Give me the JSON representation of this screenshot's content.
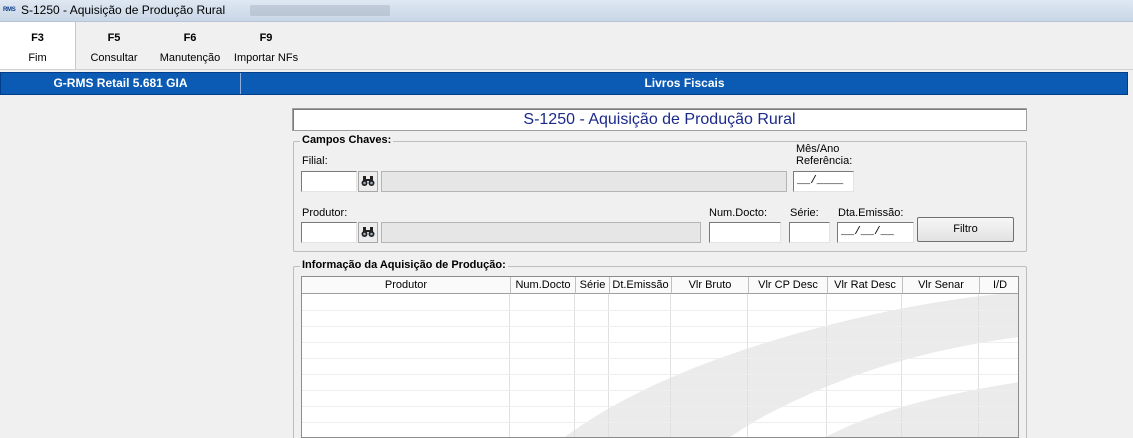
{
  "window": {
    "title": "S-1250 - Aquisição de Produção Rural",
    "icon_text": "RMS"
  },
  "toolbar": {
    "items": [
      {
        "key": "F3",
        "label": "Fim"
      },
      {
        "key": "F5",
        "label": "Consultar"
      },
      {
        "key": "F6",
        "label": "Manutenção"
      },
      {
        "key": "F9",
        "label": "Importar NFs"
      }
    ]
  },
  "bar": {
    "left": "G-RMS Retail 5.681 GIA",
    "right": "Livros Fiscais"
  },
  "form_title": "S-1250 - Aquisição de Produção Rural",
  "campos": {
    "title": "Campos Chaves:",
    "filial_label": "Filial:",
    "mesano_label": "Mês/Ano\nReferência:",
    "mesano_value": "__/____",
    "produtor_label": "Produtor:",
    "numdocto_label": "Num.Docto:",
    "serie_label": "Série:",
    "dtemissao_label": "Dta.Emissão:",
    "dtemissao_value": "__/__/__",
    "filtro_button": "Filtro"
  },
  "info": {
    "title": "Informação da Aquisição de Produção:",
    "columns": [
      "Produtor",
      "Num.Docto",
      "Série",
      "Dt.Emissão",
      "Vlr Bruto",
      "Vlr CP Desc",
      "Vlr Rat Desc",
      "Vlr Senar",
      "I/D"
    ]
  },
  "icons": {
    "lookup": "binoculars-icon"
  }
}
